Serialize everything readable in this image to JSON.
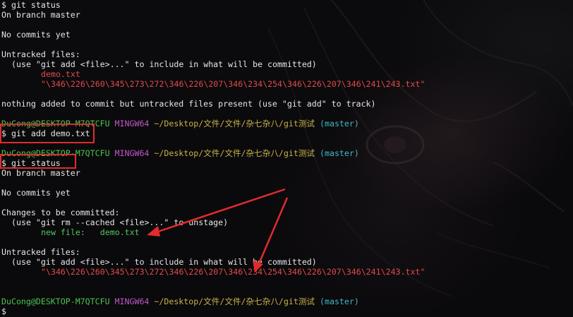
{
  "terminal": {
    "lines": {
      "l1": "$ git status",
      "l2": "On branch master",
      "l3": "No commits yet",
      "l4": "Untracked files:",
      "l5": "(use \"git add <file>...\" to include in what will be committed)",
      "l6": "demo.txt",
      "l7": "\"\\346\\226\\260\\345\\273\\272\\346\\226\\207\\346\\234\\254\\346\\226\\207\\346\\241\\243.txt\"",
      "l8": "nothing added to commit but untracked files present (use \"git add\" to track)",
      "l10": "$ git add demo.txt",
      "l12": "$ git status",
      "l13": "On branch master",
      "l14": "No commits yet",
      "l15": "Changes to be committed:",
      "l16": "(use \"git rm --cached <file>...\" to unstage)",
      "l17_label": "new file:",
      "l17_file": "demo.txt",
      "l18": "Untracked files:",
      "l19": "(use \"git add <file>...\" to include in what will be committed)",
      "l20": "\"\\346\\226\\260\\345\\273\\272\\346\\226\\207\\346\\234\\254\\346\\226\\207\\346\\241\\243.txt\"",
      "final_prompt": "$"
    },
    "prompt": {
      "user_host": "DuCong@DESKTOP-M7QTCFU",
      "shell": "MINGW64",
      "path": "~/Desktop/文件/文件/杂七杂八/git测试",
      "branch": "(master)"
    }
  },
  "colors": {
    "annotation_red": "#e12b2b",
    "untracked_red": "#e04b4b",
    "staged_green": "#4ec85a",
    "prompt_green": "#4cc552",
    "prompt_magenta": "#c058c8",
    "prompt_yellow": "#c8b24a",
    "branch_cyan": "#3fb8c6"
  }
}
